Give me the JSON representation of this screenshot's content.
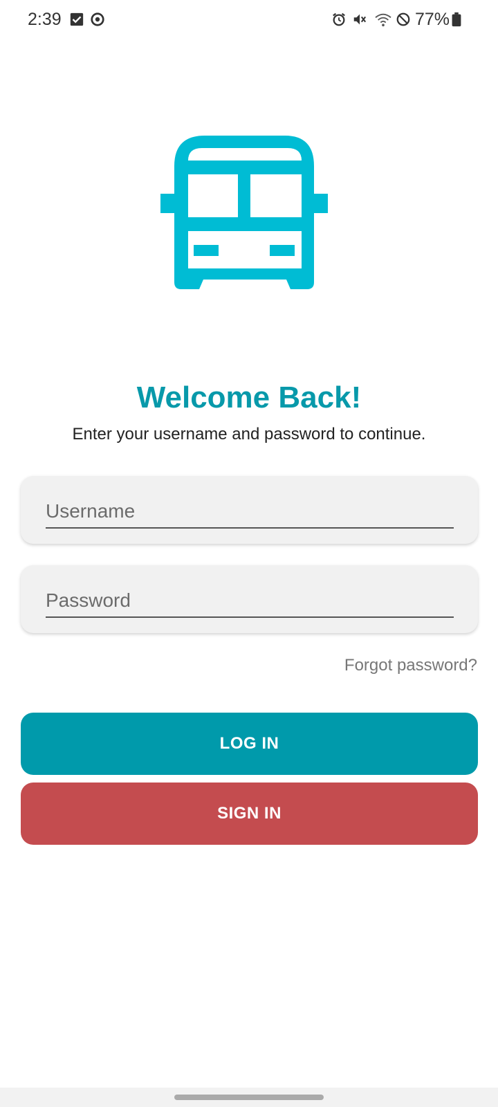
{
  "status_bar": {
    "time": "2:39",
    "battery": "77%",
    "left_icons": [
      "checkbox-icon",
      "sync-icon"
    ],
    "right_icons": [
      "alarm-icon",
      "mute-icon",
      "wifi-icon",
      "no-disturb-icon",
      "battery-icon"
    ]
  },
  "app": {
    "logo_icon": "bus-icon",
    "brand_color": "#00bcd4"
  },
  "welcome": {
    "title": "Welcome Back!",
    "subtitle": "Enter your username and password to continue."
  },
  "form": {
    "username_placeholder": "Username",
    "username_value": "",
    "password_placeholder": "Password",
    "password_value": "",
    "forgot_label": "Forgot password?"
  },
  "buttons": {
    "login_label": "LOG IN",
    "login_color": "#009aab",
    "signin_label": "SIGN IN",
    "signin_color": "#c44c4f"
  }
}
